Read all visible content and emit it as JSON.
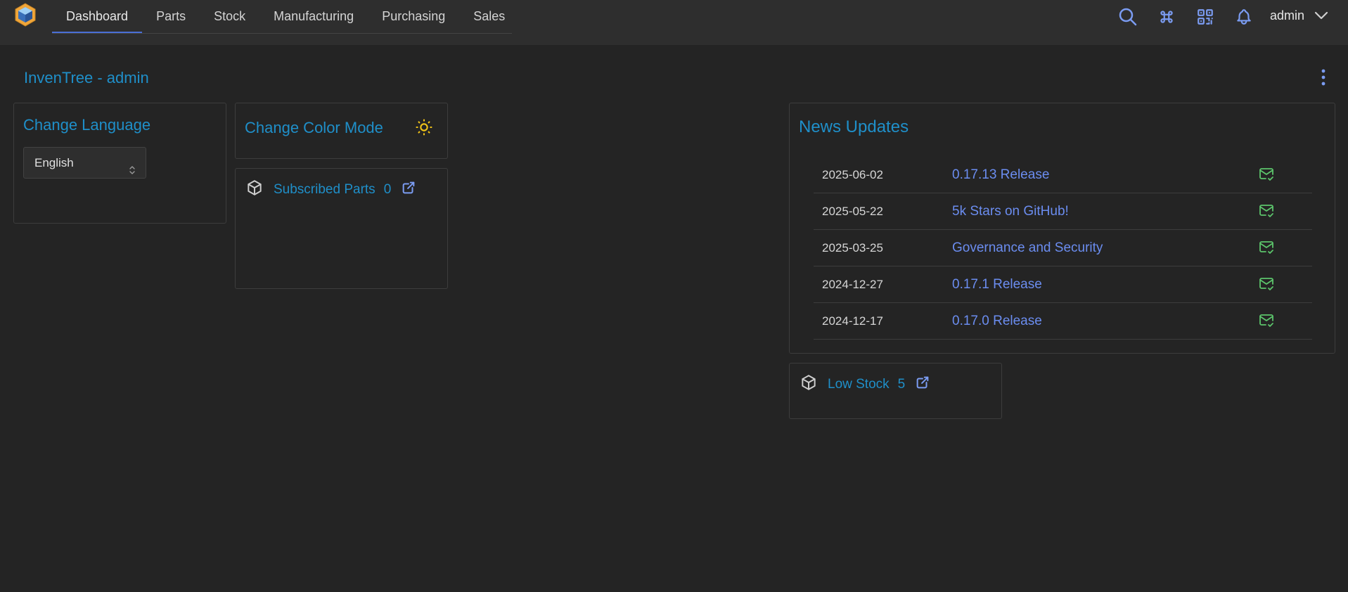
{
  "nav": {
    "tabs": [
      "Dashboard",
      "Parts",
      "Stock",
      "Manufacturing",
      "Purchasing",
      "Sales"
    ],
    "active_tab": "Dashboard",
    "icons": [
      "search-icon",
      "command-icon",
      "qr-code-icon",
      "bell-icon"
    ],
    "user": "admin"
  },
  "page": {
    "title": "InvenTree - admin"
  },
  "language_card": {
    "title": "Change Language",
    "selected": "English"
  },
  "color_card": {
    "title": "Change Color Mode"
  },
  "subscribed_parts": {
    "label": "Subscribed Parts",
    "count": "0"
  },
  "news": {
    "title": "News Updates",
    "items": [
      {
        "date": "2025-06-02",
        "title": "0.17.13 Release"
      },
      {
        "date": "2025-05-22",
        "title": "5k Stars on GitHub!"
      },
      {
        "date": "2025-03-25",
        "title": "Governance and Security"
      },
      {
        "date": "2024-12-27",
        "title": "0.17.1 Release"
      },
      {
        "date": "2024-12-17",
        "title": "0.17.0 Release"
      }
    ]
  },
  "low_stock": {
    "label": "Low Stock",
    "count": "5"
  },
  "colors": {
    "accent": "#1f8fc9",
    "link": "#6b8df0",
    "mail": "#5cc46b",
    "sun": "#f2c418",
    "active_tab": "#4a6fd6"
  }
}
